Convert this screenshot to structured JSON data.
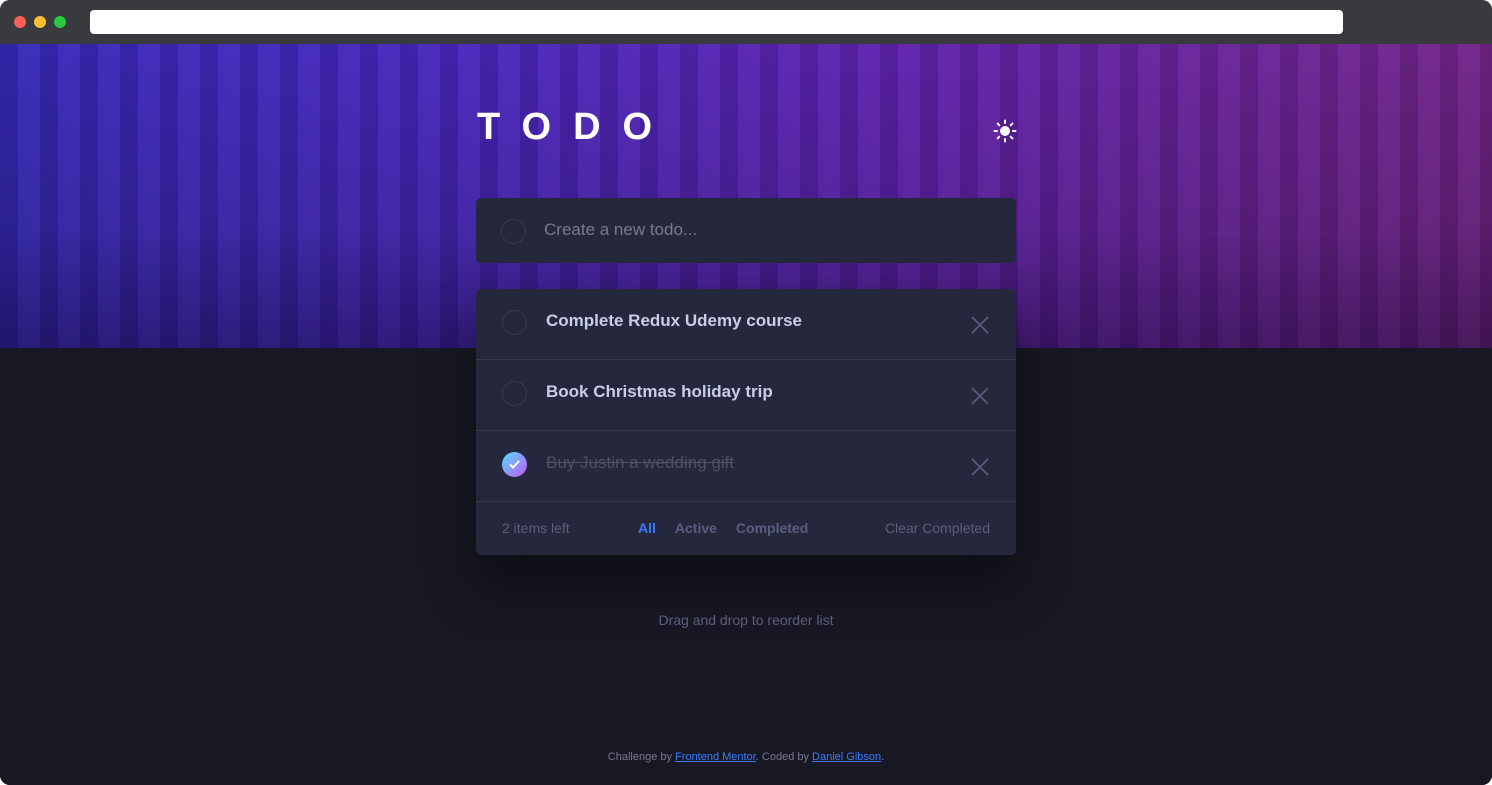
{
  "header": {
    "title": "TODO"
  },
  "new_todo": {
    "placeholder": "Create a new todo..."
  },
  "todos": [
    {
      "text": "Complete Redux Udemy course",
      "completed": false
    },
    {
      "text": "Book Christmas holiday trip",
      "completed": false
    },
    {
      "text": "Buy Justin a wedding gift",
      "completed": true
    }
  ],
  "footer_bar": {
    "items_left": "2 items left",
    "filters": [
      "All",
      "Active",
      "Completed"
    ],
    "active_filter": "All",
    "clear_label": "Clear Completed"
  },
  "hint": "Drag and drop to reorder list",
  "attribution": {
    "prefix": "Challenge by ",
    "link1": "Frontend Mentor",
    "middle": ". Coded by ",
    "link2": "Daniel Gibson",
    "suffix": "."
  },
  "icons": {
    "theme_toggle": "sun-icon",
    "delete": "cross-icon",
    "check": "check-icon"
  },
  "colors": {
    "background": "#181824",
    "card": "#25273c",
    "accent": "#3a7bfd",
    "hero_start": "#3a2bc2",
    "hero_end": "#78258f"
  }
}
